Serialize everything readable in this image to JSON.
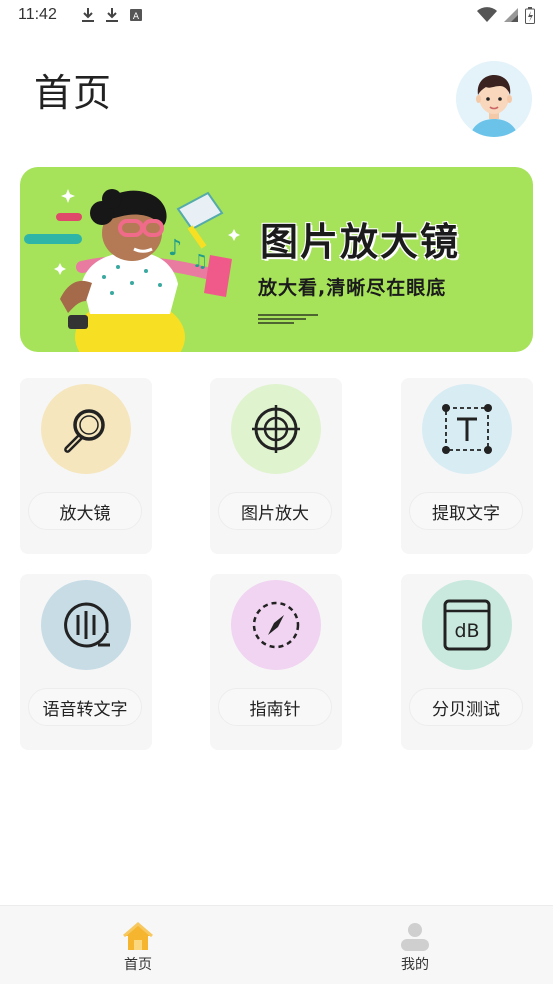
{
  "status": {
    "time": "11:42",
    "left_icons": [
      "download-icon",
      "download-icon",
      "a-box-icon"
    ],
    "right_icons": [
      "wifi-icon",
      "signal-icon",
      "battery-icon"
    ]
  },
  "header": {
    "title": "首页"
  },
  "banner": {
    "title": "图片放大镜",
    "subtitle": "放大看,清晰尽在眼底",
    "bg_color": "#a6e25a"
  },
  "features": [
    {
      "label": "放大镜",
      "icon": "magnifier-icon",
      "circle_color": "#f6e6bd"
    },
    {
      "label": "图片放大",
      "icon": "crosshair-icon",
      "circle_color": "#e0f3cf"
    },
    {
      "label": "提取文字",
      "icon": "text-extract-icon",
      "circle_color": "#d8ecf3"
    },
    {
      "label": "语音转文字",
      "icon": "voice-text-icon",
      "circle_color": "#c8dce6"
    },
    {
      "label": "指南针",
      "icon": "compass-icon",
      "circle_color": "#f0d4f1"
    },
    {
      "label": "分贝测试",
      "icon": "decibel-icon",
      "circle_color": "#c9e9df"
    }
  ],
  "tabbar": {
    "items": [
      {
        "label": "首页",
        "icon": "home-icon",
        "active": true,
        "color": "#f5b52e"
      },
      {
        "label": "我的",
        "icon": "user-icon",
        "active": false,
        "color": "#cfcfcf"
      }
    ]
  }
}
